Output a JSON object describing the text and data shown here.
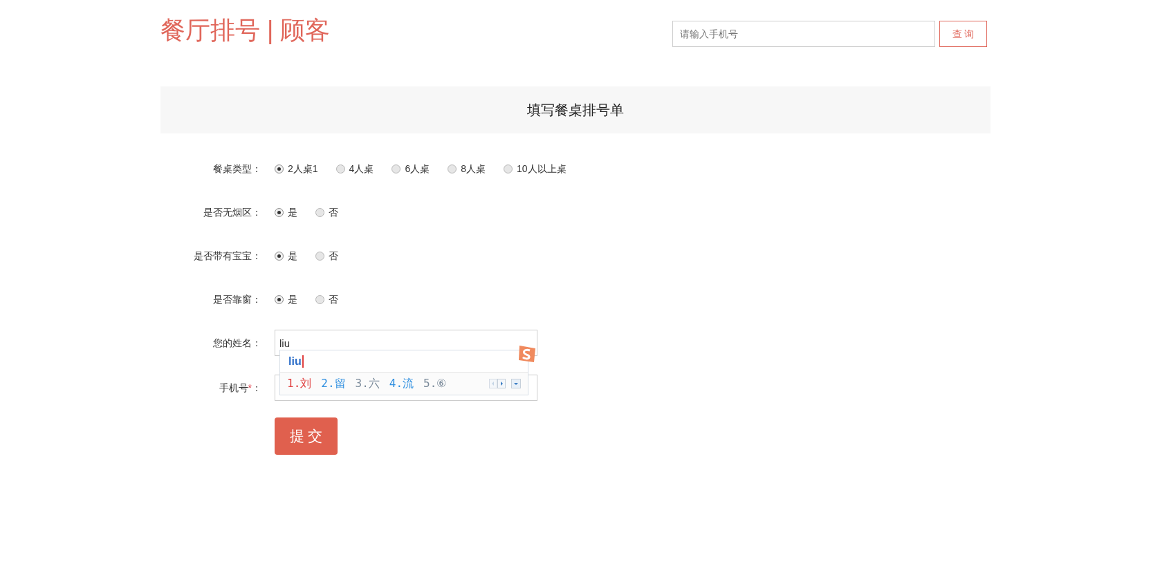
{
  "header": {
    "title": "餐厅排号 | 顾客",
    "search": {
      "placeholder": "请输入手机号"
    },
    "search_button": "查 询"
  },
  "panel_title": "填写餐桌排号单",
  "radio_groups": [
    {
      "label": "餐桌类型：",
      "options": [
        {
          "label": "2人桌1",
          "selected": true
        },
        {
          "label": "4人桌",
          "selected": false
        },
        {
          "label": "6人桌",
          "selected": false
        },
        {
          "label": "8人桌",
          "selected": false
        },
        {
          "label": "10人以上桌",
          "selected": false
        }
      ]
    },
    {
      "label": "是否无烟区：",
      "options": [
        {
          "label": "是",
          "selected": true
        },
        {
          "label": "否",
          "selected": false
        }
      ]
    },
    {
      "label": "是否带有宝宝：",
      "options": [
        {
          "label": "是",
          "selected": true
        },
        {
          "label": "否",
          "selected": false
        }
      ]
    },
    {
      "label": "是否靠窗：",
      "options": [
        {
          "label": "是",
          "selected": true
        },
        {
          "label": "否",
          "selected": false
        }
      ]
    }
  ],
  "name_field": {
    "label": "您的姓名：",
    "value": "liu"
  },
  "phone_field": {
    "label": "手机号",
    "required_mark": "*",
    "colon": "："
  },
  "ime": {
    "composition": "liu",
    "candidates": [
      {
        "index": "1.",
        "text": "刘",
        "selected": true
      },
      {
        "index": "2.",
        "text": "留",
        "selected": false
      },
      {
        "index": "3.",
        "text": "六",
        "selected": false
      },
      {
        "index": "4.",
        "text": "流",
        "selected": false
      },
      {
        "index": "5.",
        "text": "⑥",
        "selected": false
      }
    ]
  },
  "submit_button": "提 交"
}
